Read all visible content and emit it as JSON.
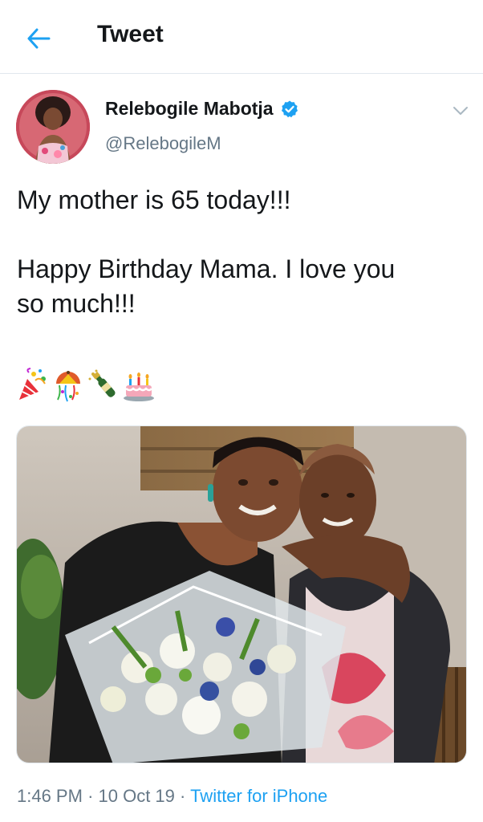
{
  "header": {
    "title": "Tweet",
    "back_icon": "arrow-left-icon"
  },
  "author": {
    "display_name": "Relebogile Mabotja",
    "handle": "@RelebogileM",
    "verified": true
  },
  "tweet": {
    "line1": "My mother is 65 today!!!",
    "line2": "Happy Birthday Mama. I love you",
    "line3": "so much!!!",
    "emojis": [
      "party-popper",
      "confetti-ball",
      "champagne",
      "birthday-cake"
    ]
  },
  "meta": {
    "time": "1:46 PM",
    "sep1": "·",
    "date": "10 Oct 19",
    "sep2": "·",
    "source": "Twitter for iPhone"
  },
  "colors": {
    "accent": "#1da1f2",
    "text": "#14171a",
    "secondary": "#657786",
    "divider": "#e1e8ed"
  }
}
